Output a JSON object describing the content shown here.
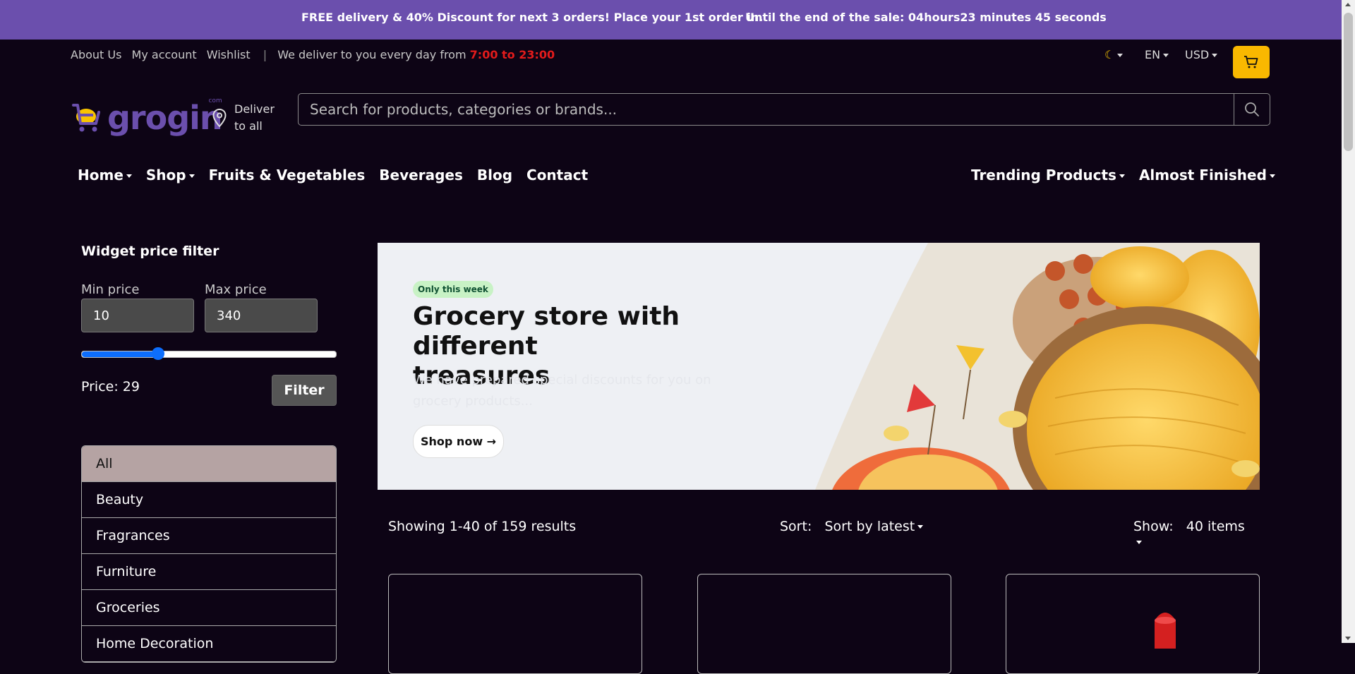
{
  "topbar": {
    "promo": "FREE delivery & 40% Discount for next 3 orders! Place your 1st order in.",
    "sale_prefix": "Until the end of the sale:",
    "hours_value": "04",
    "hours_label": "hours",
    "minutes_value": "23",
    "minutes_label": "minutes",
    "seconds_value": "45",
    "seconds_label": "seconds"
  },
  "utility": {
    "links": [
      "About Us",
      "My account",
      "Wishlist"
    ],
    "delivery_text": "We deliver to you every day from",
    "delivery_hours": "7:00 to 23:00",
    "theme_icon": "moon-icon",
    "language": "EN",
    "currency": "USD"
  },
  "header": {
    "logo_text": "grogin",
    "logo_suffix": "com",
    "deliver_line1": "Deliver",
    "deliver_line2": "to all",
    "search_placeholder": "Search for products, categories or brands..."
  },
  "nav": {
    "left": [
      {
        "label": "Home",
        "dropdown": true
      },
      {
        "label": "Shop",
        "dropdown": true
      },
      {
        "label": "Fruits & Vegetables",
        "dropdown": false
      },
      {
        "label": "Beverages",
        "dropdown": false
      },
      {
        "label": "Blog",
        "dropdown": false
      },
      {
        "label": "Contact",
        "dropdown": false
      }
    ],
    "right": [
      {
        "label": "Trending Products",
        "dropdown": true
      },
      {
        "label": "Almost Finished",
        "dropdown": true
      }
    ]
  },
  "sidebar": {
    "title": "Widget price filter",
    "min_label": "Min price",
    "max_label": "Max price",
    "min_value": "10",
    "max_value": "340",
    "slider_fraction": 0.3,
    "price_text": "Price: 29",
    "filter_button": "Filter",
    "categories": [
      "All",
      "Beauty",
      "Fragrances",
      "Furniture",
      "Groceries",
      "Home Decoration"
    ],
    "active_category": "All"
  },
  "banner": {
    "badge": "Only this week",
    "title": "Grocery store with different treasures",
    "subtitle": "We have prepared special discounts for you on grocery products...",
    "button": "Shop now →"
  },
  "results": {
    "showing": "Showing 1-40 of 159 results",
    "sort_label": "Sort:",
    "sort_value": "Sort by latest",
    "show_label": "Show:",
    "show_value": "40 items"
  },
  "colors": {
    "brand": "#6b4fad",
    "cart": "#f9b800",
    "hours": "#e21b1b",
    "accent": "#0d6efd"
  }
}
